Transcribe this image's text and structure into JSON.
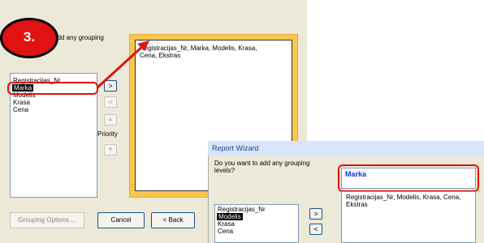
{
  "step_badge": "3.",
  "wizard_main": {
    "prompt": "add any grouping",
    "fields": [
      "Registracijas_Nr",
      "Marka",
      "Modelis",
      "Krasa",
      "Cena"
    ],
    "selected_field": "Marka",
    "buttons": {
      "add": ">",
      "remove": "<"
    },
    "priority_label": "Priority",
    "priority_up": "▲",
    "priority_down": "▼",
    "preview_text": "Registracijas_Nr, Marka, Modelis, Krasa, Cena, Ekstras",
    "grouping_options": "Grouping Options ...",
    "cancel": "Cancel",
    "back": "< Back"
  },
  "report_wizard": {
    "title": "Report Wizard",
    "question": "Do you want to add any grouping levels?",
    "group_level": "Marka",
    "detail_text": "Registracijas_Nr, Modelis, Krasa, Cena, Ekstras",
    "fields": [
      "Registracijas_Nr",
      "Modelis",
      "Krasa",
      "Cena"
    ],
    "selected_field": "Modelis",
    "buttons": {
      "add": ">",
      "remove": "<"
    }
  },
  "colors": {
    "accent": "#e01212",
    "group_blue": "#1b2fd0",
    "preview_frame": "#f8c74f",
    "dialog_bg": "#ece9d8"
  }
}
